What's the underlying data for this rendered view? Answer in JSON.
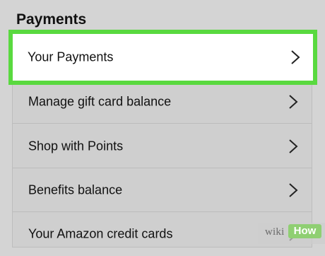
{
  "section": {
    "title": "Payments"
  },
  "menu": {
    "items": [
      {
        "label": "Your Payments",
        "icon": "chevron-right-icon",
        "highlighted": true
      },
      {
        "label": "Manage gift card balance",
        "icon": "chevron-right-icon"
      },
      {
        "label": "Shop with Points",
        "icon": "chevron-right-icon"
      },
      {
        "label": "Benefits balance",
        "icon": "chevron-right-icon"
      },
      {
        "label": "Your Amazon credit cards",
        "icon": "chevron-right-icon"
      }
    ]
  },
  "watermark": {
    "prefix": "wiki",
    "suffix": "How"
  },
  "colors": {
    "highlight_border": "#59d93f",
    "page_background": "#d4d4d4",
    "highlighted_item_background": "#ffffff"
  }
}
